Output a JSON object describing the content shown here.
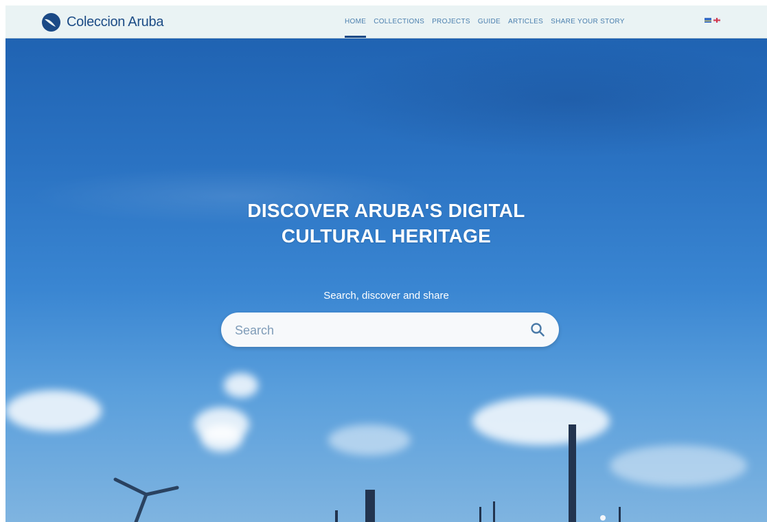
{
  "header": {
    "brand": "Coleccion Aruba",
    "nav": [
      {
        "label": "HOME",
        "active": true
      },
      {
        "label": "COLLECTIONS",
        "active": false
      },
      {
        "label": "PROJECTS",
        "active": false
      },
      {
        "label": "GUIDE",
        "active": false
      },
      {
        "label": "ARTICLES",
        "active": false
      },
      {
        "label": "SHARE YOUR STORY",
        "active": false
      }
    ],
    "languages": [
      "aruba-flag-icon",
      "uk-flag-icon"
    ]
  },
  "hero": {
    "title": "DISCOVER ARUBA'S DIGITAL\nCULTURAL HERITAGE",
    "subtitle": "Search, discover and share",
    "search": {
      "placeholder": "Search",
      "value": ""
    }
  },
  "colors": {
    "brand": "#1b4a86",
    "header_bg": "#eaf3f4",
    "nav_text": "#4a7fae",
    "sky_top": "#1d5fae",
    "sky_bottom": "#7fb4e0"
  }
}
